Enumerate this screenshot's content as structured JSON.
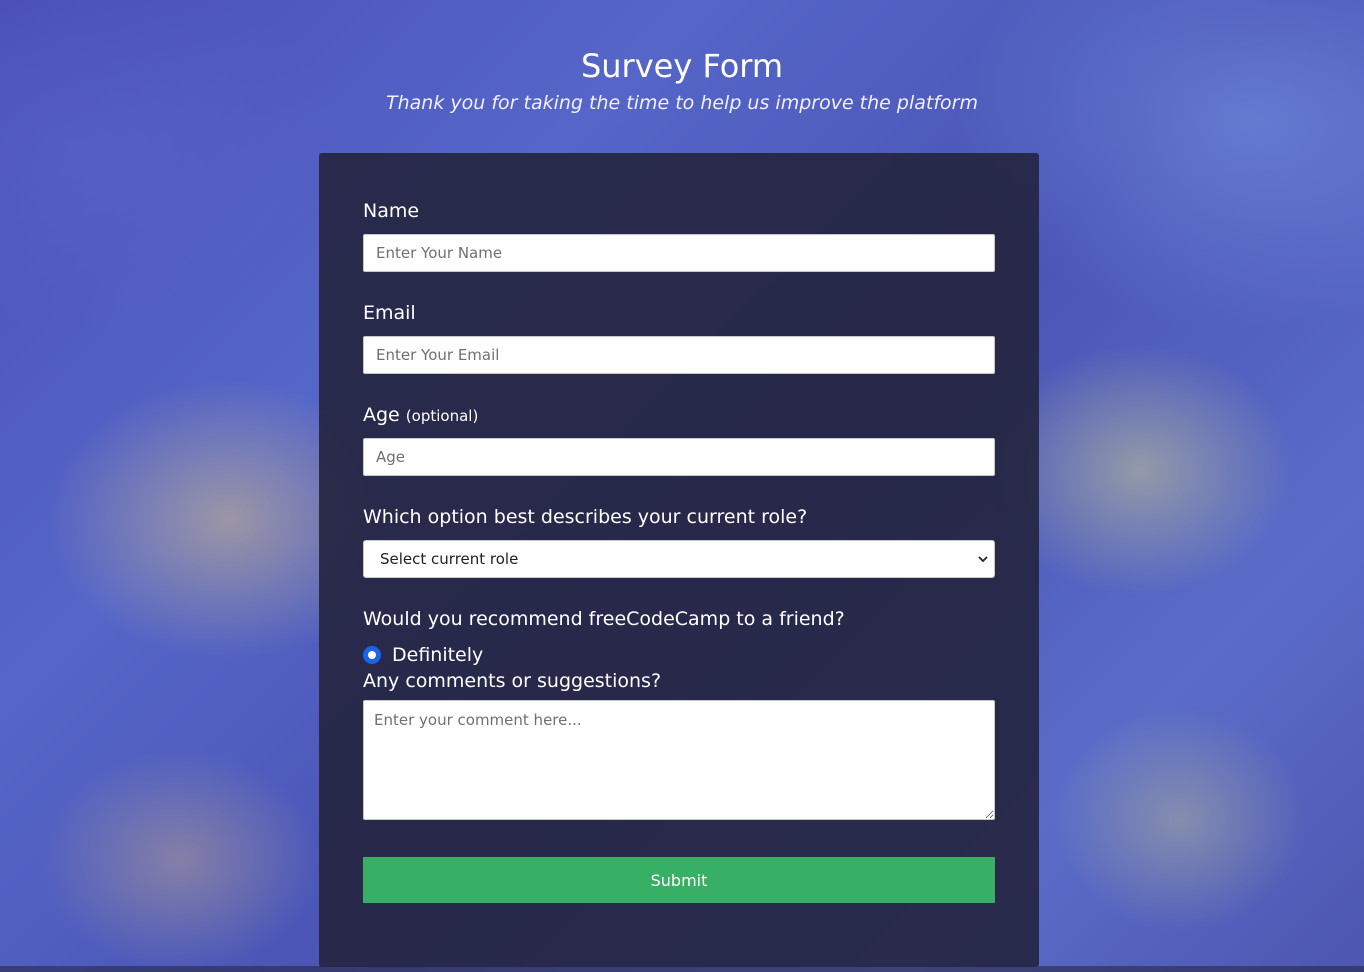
{
  "header": {
    "title": "Survey Form",
    "description": "Thank you for taking the time to help us improve the platform"
  },
  "form": {
    "name": {
      "label": "Name",
      "placeholder": "Enter Your Name",
      "value": ""
    },
    "email": {
      "label": "Email",
      "placeholder": "Enter Your Email",
      "value": ""
    },
    "age": {
      "label": "Age",
      "hint": "(optional)",
      "placeholder": "Age",
      "value": ""
    },
    "role": {
      "label": "Which option best describes your current role?",
      "selected": "Select current role"
    },
    "recommend": {
      "label": "Would you recommend freeCodeCamp to a friend?",
      "options": [
        {
          "label": "Definitely",
          "checked": true
        }
      ]
    },
    "comments": {
      "label": "Any comments or suggestions?",
      "placeholder": "Enter your comment here..."
    },
    "submit_label": "Submit"
  },
  "colors": {
    "card_background": "#24243e",
    "submit_button": "#37af65",
    "radio_accent": "#1a63e8",
    "text": "#ffffff"
  }
}
